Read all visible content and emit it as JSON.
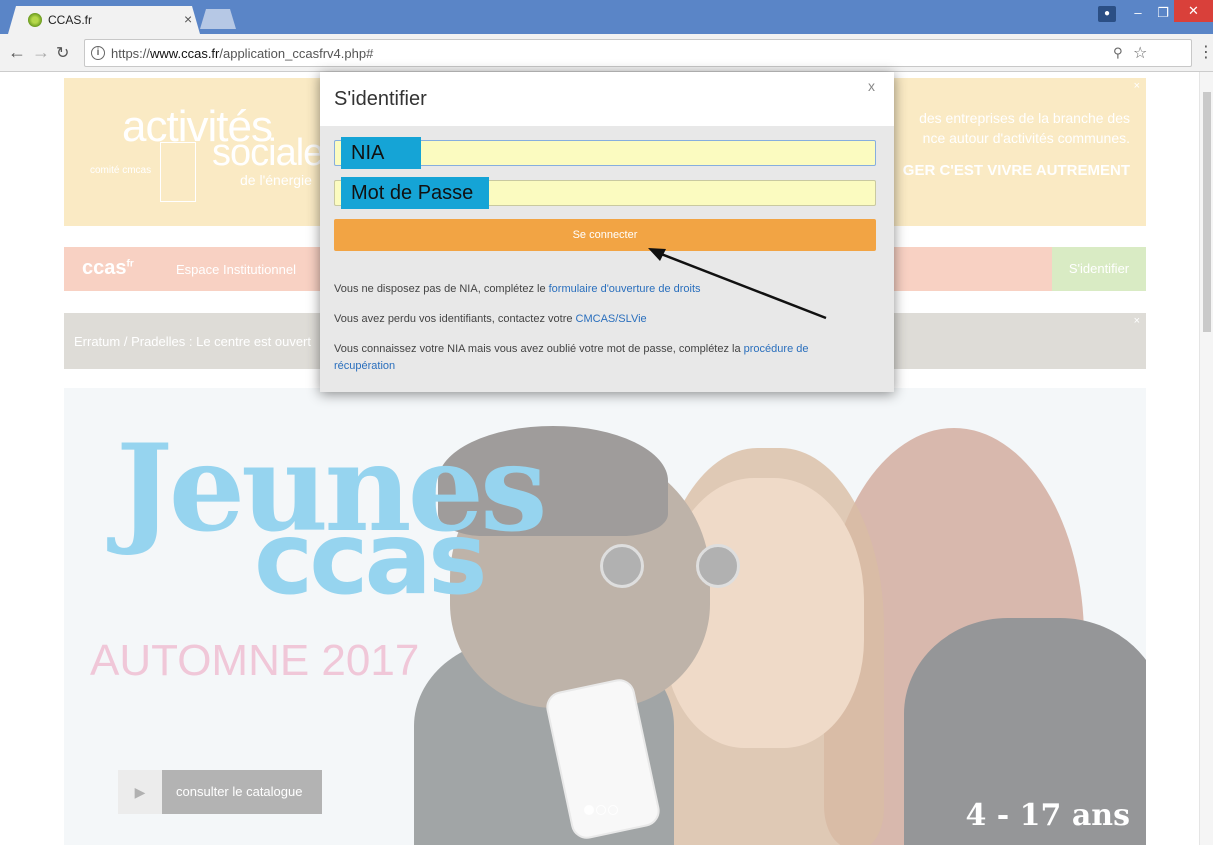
{
  "browser": {
    "tab_title": "CCAS.fr",
    "tab_close": "×",
    "url_prefix": "https://",
    "url_host": "www.ccas.fr",
    "url_path": "/application_ccasfrv4.php#"
  },
  "banner": {
    "logo_line1": "activités",
    "logo_line2": "sociales",
    "logo_line3": "de l'énergie",
    "logo_cmcas": "comité cmcas",
    "text1": "des entreprises de la branche des",
    "text2": "nce autour d'activités communes.",
    "text3": "GER C'EST VIVRE AUTREMENT"
  },
  "nav": {
    "logo": "ccas",
    "logo_sup": "fr",
    "institutional": "Espace Institutionnel",
    "login": "S'identifier"
  },
  "erratum": {
    "text": "Erratum / Pradelles : Le centre est ouvert"
  },
  "hero": {
    "title1": "Jeunes",
    "title2": "ccas",
    "season": "AUTOMNE 2017",
    "cta": "consulter le catalogue",
    "age": "4 - 17 ans"
  },
  "modal": {
    "title": "S'identifier",
    "close": "x",
    "nia_label": "NIA",
    "password_label": "Mot de Passe",
    "submit": "Se connecter",
    "line1_text": "Vous ne disposez pas de NIA, complétez le ",
    "line1_link": "formulaire d'ouverture de droits",
    "line2_text": "Vous avez perdu vos identifiants, contactez votre ",
    "line2_link": "CMCAS/SLVie",
    "line3_text": "Vous connaissez votre NIA mais vous avez oublié votre mot de passe, complétez la ",
    "line3_link": "procédure de récupération"
  },
  "colors": {
    "accent_orange": "#f2a444",
    "field_yellow": "#fbfbc0",
    "label_blue": "#15a4d6",
    "hero_blue": "#5fbde6",
    "hero_pink": "#e8a9c4"
  }
}
